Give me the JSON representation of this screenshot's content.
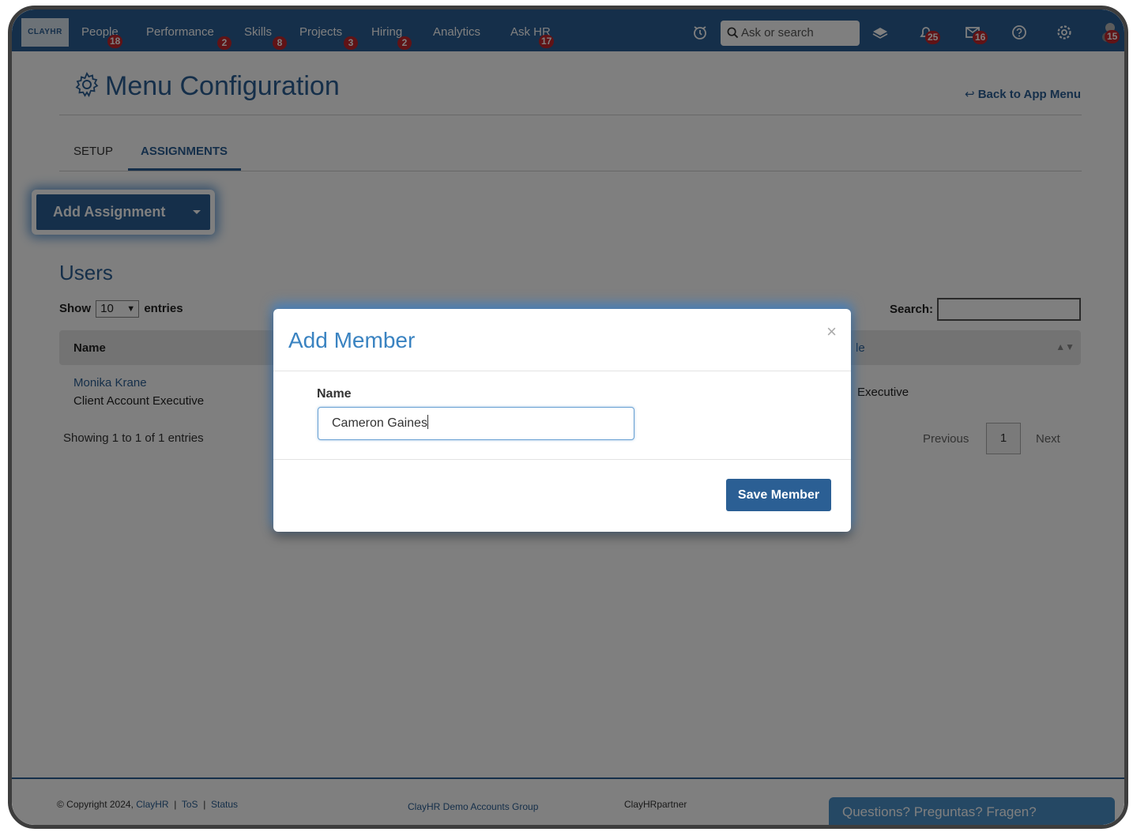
{
  "nav": {
    "logo_text": "CLAYHR",
    "items": [
      {
        "label": "People",
        "badge": "18"
      },
      {
        "label": "Performance",
        "badge": "2"
      },
      {
        "label": "Skills",
        "badge": "8"
      },
      {
        "label": "Projects",
        "badge": "3"
      },
      {
        "label": "Hiring",
        "badge": "2"
      },
      {
        "label": "Analytics",
        "badge": ""
      },
      {
        "label": "Ask HR",
        "badge": "17"
      }
    ],
    "search_placeholder": "Ask or search",
    "notifications_badge": "25",
    "messages_badge": "16",
    "avatar_badge": "15",
    "icons": [
      "alarm-clock-icon",
      "search-icon",
      "layers-icon",
      "bell-icon",
      "mail-icon",
      "help-icon",
      "gear-icon",
      "avatar"
    ]
  },
  "page": {
    "title": "Menu Configuration",
    "back_link": "Back to App Menu",
    "tabs": [
      {
        "label": "SETUP",
        "active": false
      },
      {
        "label": "ASSIGNMENTS",
        "active": true
      }
    ],
    "add_assignment_label": "Add Assignment"
  },
  "users": {
    "title": "Users",
    "show_label": "Show",
    "entries_value": "10",
    "entries_label": "entries",
    "search_label": "Search:",
    "search_value": "",
    "columns": [
      "Name",
      "le"
    ],
    "rows": [
      {
        "name": "Monika Krane",
        "title": "Client Account Executive",
        "role": "Executive"
      }
    ],
    "showing": "Showing 1 to 1 of 1 entries",
    "pager": {
      "previous": "Previous",
      "page": "1",
      "next": "Next"
    }
  },
  "footer": {
    "copyright": "© Copyright 2024,",
    "company_link": "ClayHR",
    "tos": "ToS",
    "status": "Status",
    "group": "ClayHR Demo Accounts Group",
    "partner": "ClayHRpartner",
    "questions": "Questions? Preguntas? Fragen?"
  },
  "modal": {
    "title": "Add Member",
    "close": "×",
    "name_label": "Name",
    "name_value": "Cameron Gaines",
    "save_label": "Save Member"
  },
  "colors": {
    "brand": "#2b5f94",
    "badge": "#c0262d",
    "modal_title": "#3a83c1",
    "questions_bg": "#4a90c9"
  }
}
